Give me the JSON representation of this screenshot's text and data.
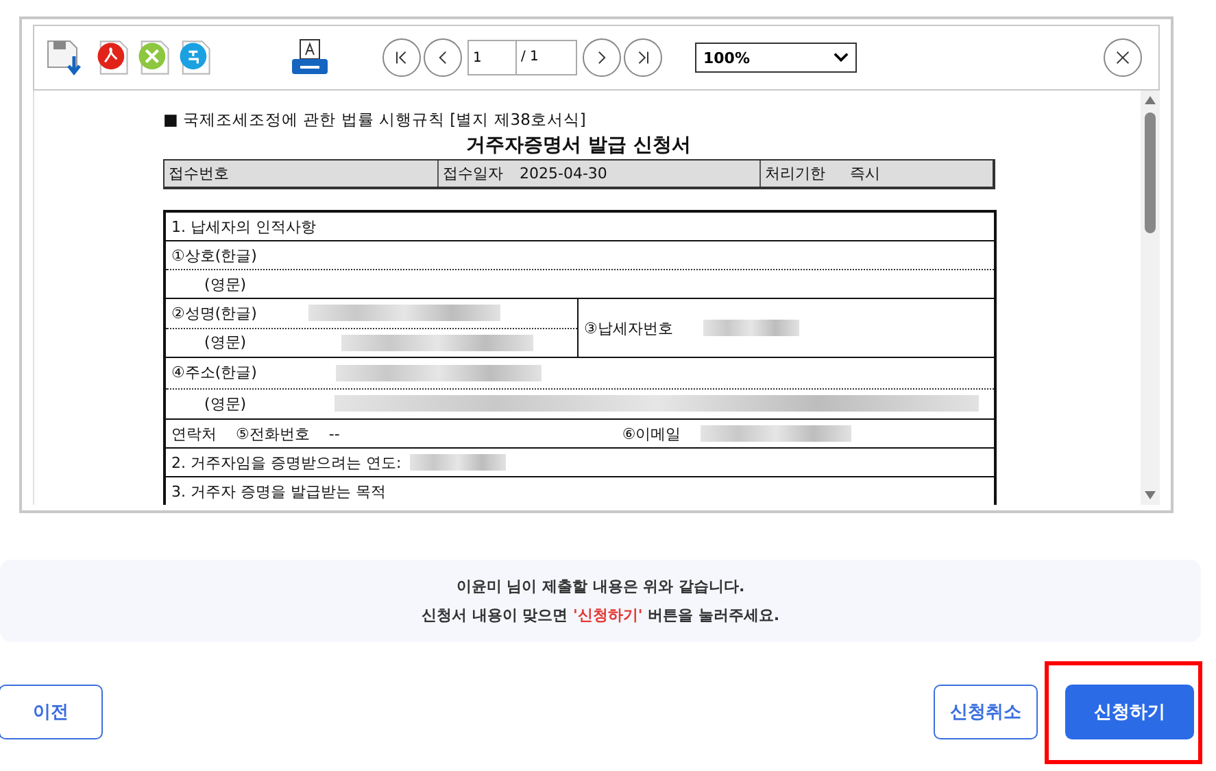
{
  "toolbar": {
    "page": "1",
    "page_total": "/ 1",
    "zoom": "100%"
  },
  "document": {
    "form_ref": "■ 국제조세조정에 관한 법률 시행규칙 [별지 제38호서식]",
    "title": "거주자증명서 발급 신청서",
    "receipt": [
      {
        "label": "접수번호"
      },
      {
        "label": "접수일자",
        "value": "2025-04-30"
      },
      {
        "label": "처리기한",
        "value": "즉시"
      }
    ],
    "section1": {
      "heading": "1. 납세자의 인적사항",
      "company_label": "①상호(한글)",
      "company_en_label": "(영문)",
      "name_label": "②성명(한글)",
      "name_en_label": "(영문)",
      "taxpayer_no_label": "③납세자번호",
      "address_label": "④주소(한글)",
      "address_en_label": "(영문)",
      "contact_label": "연락처",
      "phone_label": "⑤전화번호",
      "phone": "--",
      "email_label": "⑥이메일"
    },
    "section2": {
      "heading": "2. 거주자임을 증명받으려는 연도:"
    },
    "section3": {
      "heading": "3. 거주자 증명을 발급받는 목적"
    }
  },
  "notice": {
    "line1": "이윤미 님이 제출할 내용은 위와 같습니다.",
    "line2_before": "신청서 내용이 맞으면 ",
    "line2_highlight": "'신청하기'",
    "line2_after": " 버튼을 눌러주세요."
  },
  "buttons": [
    {
      "label": "이전",
      "kind": "secondary",
      "highlighted": false
    },
    {
      "label": "신청취소",
      "kind": "secondary",
      "highlighted": false
    },
    {
      "label": "신청하기",
      "kind": "primary",
      "highlighted": true
    }
  ]
}
